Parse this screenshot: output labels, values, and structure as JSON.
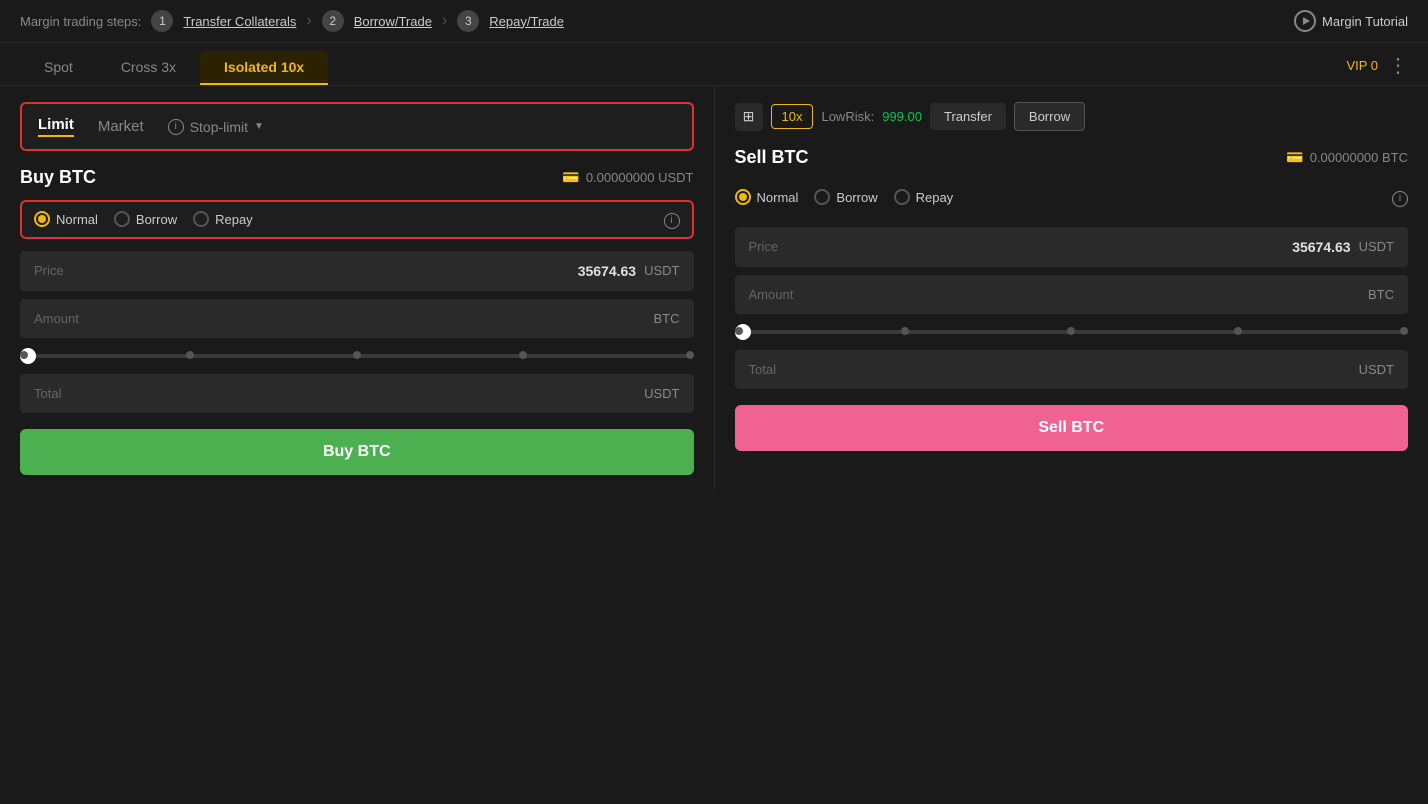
{
  "topBar": {
    "label": "Margin trading steps:",
    "step1Num": "1",
    "step1Link": "Transfer Collaterals",
    "step2Num": "2",
    "step2Link": "Borrow/Trade",
    "step3Num": "3",
    "step3Link": "Repay/Trade",
    "tutorialLabel": "Margin Tutorial"
  },
  "tabs": {
    "spot": "Spot",
    "cross": "Cross 3x",
    "isolated": "Isolated",
    "isolatedLeverage": "10x"
  },
  "vip": "VIP 0",
  "rightControls": {
    "leverage": "10x",
    "lowRiskLabel": "LowRisk:",
    "lowRiskValue": "999.00",
    "transferLabel": "Transfer",
    "borrowLabel": "Borrow"
  },
  "orderTypes": {
    "limit": "Limit",
    "market": "Market",
    "stopLimit": "Stop-limit"
  },
  "buyPanel": {
    "title": "Buy BTC",
    "balance": "0.00000000 USDT",
    "radioNormal": "Normal",
    "radioBorrow": "Borrow",
    "radioRepay": "Repay",
    "priceLabel": "Price",
    "priceValue": "35674.63",
    "priceCurrency": "USDT",
    "amountLabel": "Amount",
    "amountCurrency": "BTC",
    "totalLabel": "Total",
    "totalCurrency": "USDT",
    "buttonLabel": "Buy BTC"
  },
  "sellPanel": {
    "title": "Sell BTC",
    "balance": "0.00000000 BTC",
    "radioNormal": "Normal",
    "radioBorrow": "Borrow",
    "radioRepay": "Repay",
    "priceLabel": "Price",
    "priceValue": "35674.63",
    "priceCurrency": "USDT",
    "amountLabel": "Amount",
    "amountCurrency": "BTC",
    "totalLabel": "Total",
    "totalCurrency": "USDT",
    "buttonLabel": "Sell BTC"
  },
  "colors": {
    "accent": "#f0b90b",
    "buy": "#4caf50",
    "sell": "#f06292",
    "border_red": "#e03030",
    "lowrisk": "#00c853"
  }
}
